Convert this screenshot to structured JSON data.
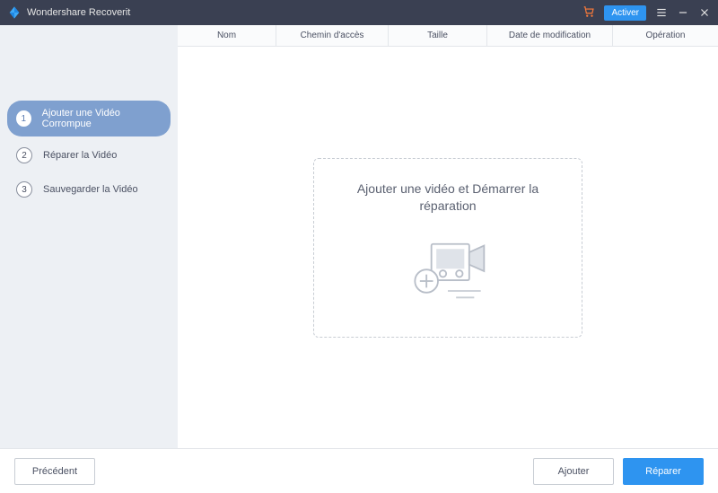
{
  "titlebar": {
    "app_title": "Wondershare Recoverit",
    "activate_label": "Activer"
  },
  "sidebar": {
    "steps": [
      {
        "num": "1",
        "label": "Ajouter une Vidéo Corrompue"
      },
      {
        "num": "2",
        "label": "Réparer la Vidéo"
      },
      {
        "num": "3",
        "label": "Sauvegarder la Vidéo"
      }
    ]
  },
  "table": {
    "columns": {
      "name": "Nom",
      "path": "Chemin d'accès",
      "size": "Taille",
      "date": "Date de modification",
      "operation": "Opération"
    }
  },
  "dropzone": {
    "text": "Ajouter une vidéo et Démarrer la réparation"
  },
  "footer": {
    "back": "Précédent",
    "add": "Ajouter",
    "repair": "Réparer"
  }
}
